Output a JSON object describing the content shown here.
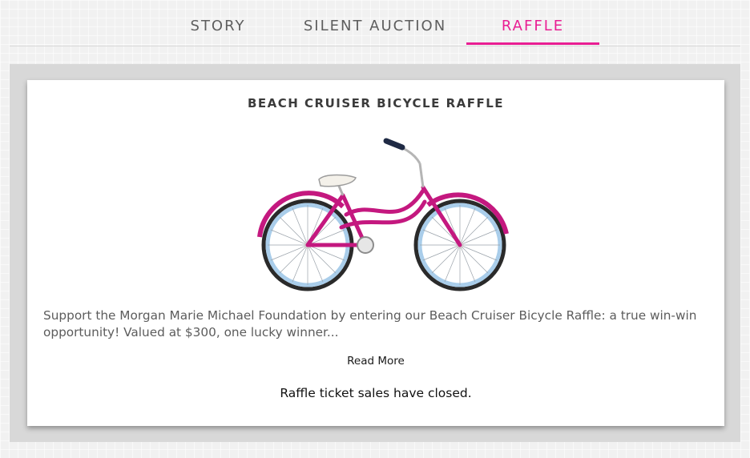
{
  "tabs": [
    {
      "label": "STORY",
      "active": false
    },
    {
      "label": "SILENT AUCTION",
      "active": false
    },
    {
      "label": "RAFFLE",
      "active": true
    }
  ],
  "colors": {
    "accent": "#e91e93",
    "bike_frame": "#c4187f",
    "tire_rim": "#a9cdea"
  },
  "raffle": {
    "title": "BEACH CRUISER BICYCLE RAFFLE",
    "image": "pink-beach-cruiser-bicycle",
    "description": "Support the Morgan Marie Michael Foundation by entering our Beach Cruiser Bicycle Raffle: a true win-win opportunity! Valued at $300, one lucky winner...",
    "read_more": "Read More",
    "status": "Raffle ticket sales have closed."
  }
}
